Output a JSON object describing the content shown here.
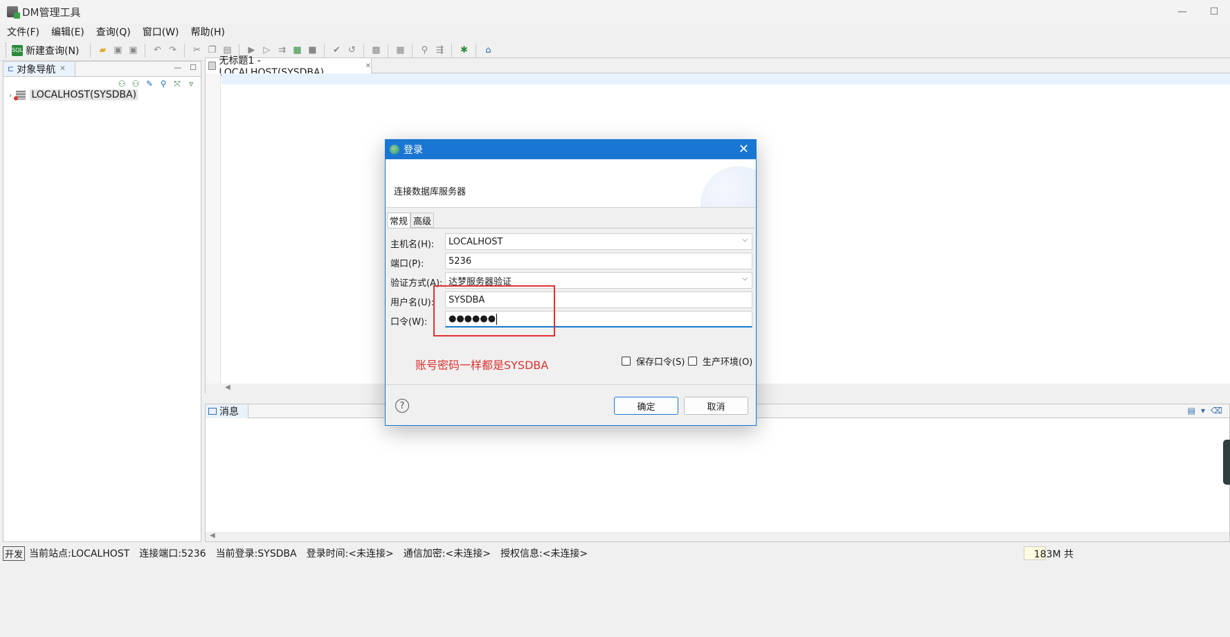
{
  "window": {
    "title": "DM管理工具",
    "minimize": "—",
    "maximize": "☐"
  },
  "menu": [
    "文件(F)",
    "编辑(E)",
    "查询(Q)",
    "窗口(W)",
    "帮助(H)"
  ],
  "toolbar": {
    "new_query": "新建查询(N)",
    "sql_badge": "SQL"
  },
  "nav_panel": {
    "tab_label": "对象导航",
    "tree_item": "LOCALHOST(SYSDBA)"
  },
  "editor": {
    "tab_label": "无标题1 - LOCALHOST(SYSDBA)"
  },
  "messages": {
    "tab_label": "消息"
  },
  "status": {
    "mode": "开发",
    "site": "当前站点:LOCALHOST",
    "port": "连接端口:5236",
    "login": "当前登录:SYSDBA",
    "login_time": "登录时间:<未连接>",
    "encryption": "通信加密:<未连接>",
    "license": "授权信息:<未连接>",
    "memory": "183M 共"
  },
  "dialog": {
    "title": "登录",
    "subtitle": "连接数据库服务器",
    "tabs": [
      "常规",
      "高级"
    ],
    "fields": {
      "host_label": "主机名(H):",
      "host_value": "LOCALHOST",
      "port_label": "端口(P):",
      "port_value": "5236",
      "auth_label": "验证方式(A):",
      "auth_value": "达梦服务器验证",
      "user_label": "用户名(U):",
      "user_value": "SYSDBA",
      "pwd_label": "口令(W):",
      "pwd_mask": "●●●●●●"
    },
    "annotation": "账号密码一样都是SYSDBA",
    "save_pwd": "保存口令(S)",
    "prod_env": "生产环境(O)",
    "help": "?",
    "ok": "确定",
    "cancel": "取消"
  },
  "colors": {
    "accent": "#1976d2",
    "annotation": "#e03131"
  }
}
